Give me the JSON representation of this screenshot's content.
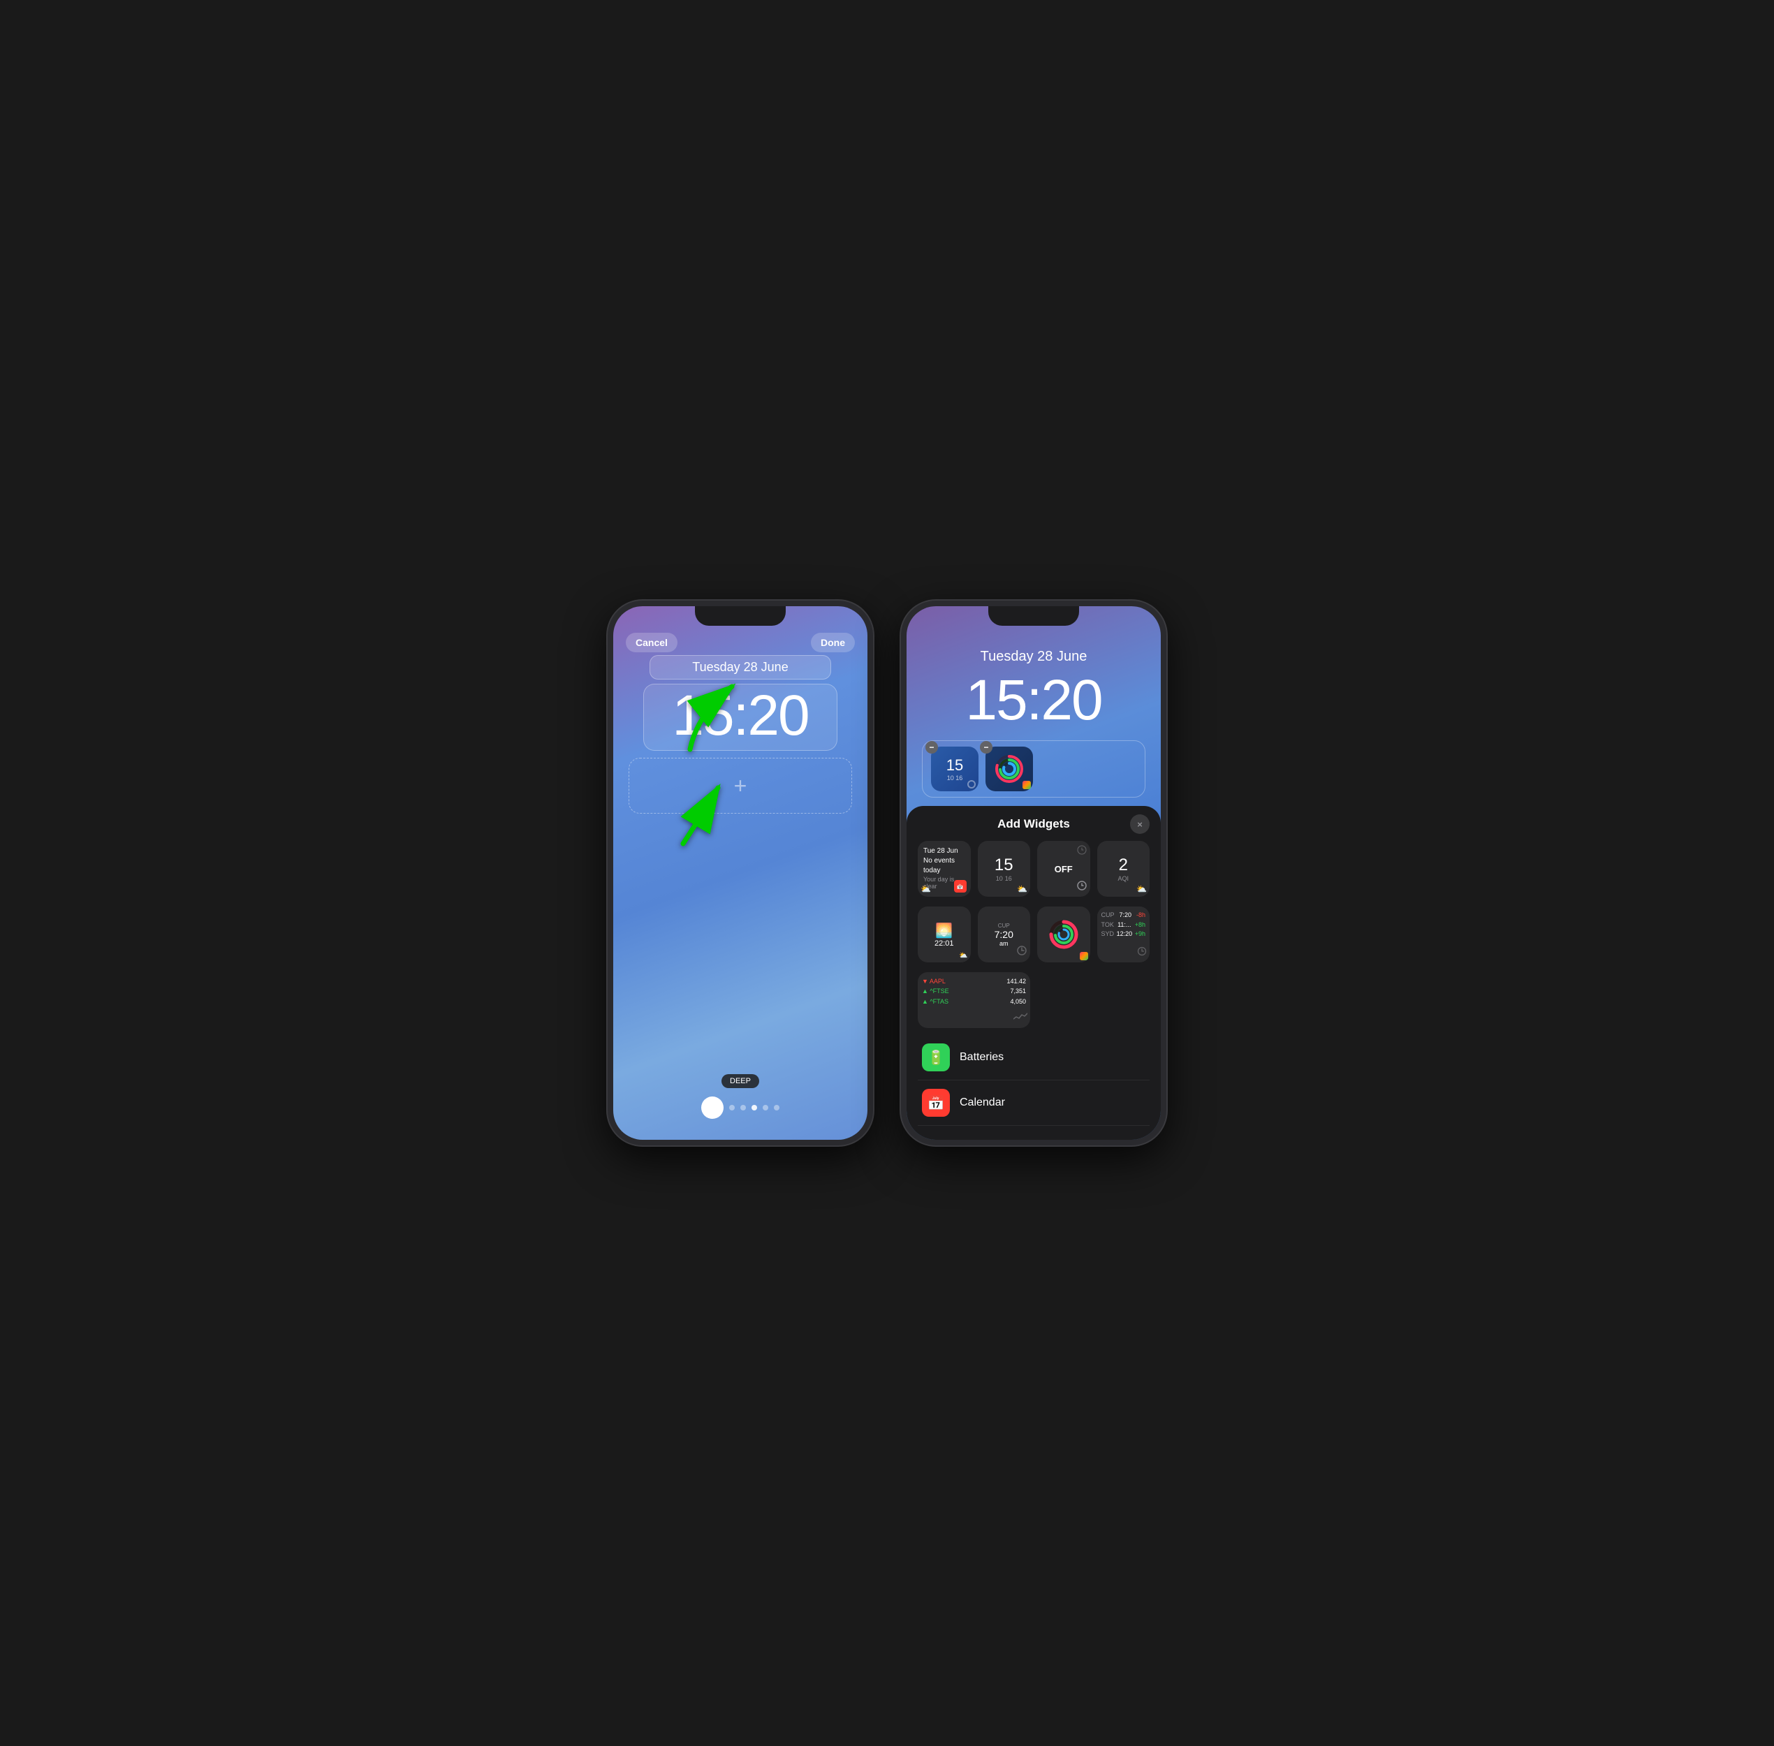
{
  "phone1": {
    "top_buttons": {
      "cancel": "Cancel",
      "done": "Done"
    },
    "date": "Tuesday 28 June",
    "time": "15:20",
    "widget_placeholder_icon": "+",
    "bottom_badge": "DEEP",
    "page_dots_count": 6,
    "active_dot_index": 0
  },
  "phone2": {
    "date": "Tuesday 28 June",
    "time": "15:20",
    "widget1": {
      "number": "15",
      "sub": "10  16"
    },
    "add_widgets_panel": {
      "title": "Add Widgets",
      "close_icon": "×",
      "widgets": [
        {
          "type": "calendar",
          "date": "Tue 28 Jun",
          "line1": "No events today",
          "line2": "Your day is clear",
          "has_calendar_icon": true,
          "has_weather_icon": true
        },
        {
          "type": "clock",
          "number": "15",
          "sub1": "10",
          "sub2": "16",
          "has_weather_icon": true
        },
        {
          "type": "alarm",
          "label": "OFF",
          "has_clock_icon": true
        },
        {
          "type": "aqi",
          "number": "2",
          "label": "AQI",
          "has_weather_icon": true
        },
        {
          "type": "sunset",
          "time": "22:01",
          "has_weather_icon": true
        },
        {
          "type": "worldclock",
          "label": "CUP",
          "time": "7:20",
          "period": "am",
          "has_clock_icon": true
        },
        {
          "type": "activity"
        },
        {
          "type": "worldclocks",
          "rows": [
            {
              "city": "CUP",
              "time": "7:20",
              "offset": "-8h"
            },
            {
              "city": "TOK",
              "time": "11:...",
              "offset": "+8h"
            },
            {
              "city": "SYD",
              "time": "12:20",
              "offset": "+9h"
            }
          ],
          "has_clock_icon": true
        },
        {
          "type": "stocks",
          "rows": [
            {
              "symbol": "▼ AAPL",
              "value": "141.42"
            },
            {
              "symbol": "▲ ^FTSE",
              "value": "7,351"
            },
            {
              "symbol": "▲ ^FTAS",
              "value": "4,050"
            }
          ],
          "has_chart": true
        }
      ],
      "list_items": [
        {
          "id": "batteries",
          "icon": "🔋",
          "icon_bg": "#30d158",
          "label": "Batteries"
        },
        {
          "id": "calendar",
          "icon": "📅",
          "icon_bg": "#ff3b30",
          "label": "Calendar"
        }
      ]
    }
  }
}
